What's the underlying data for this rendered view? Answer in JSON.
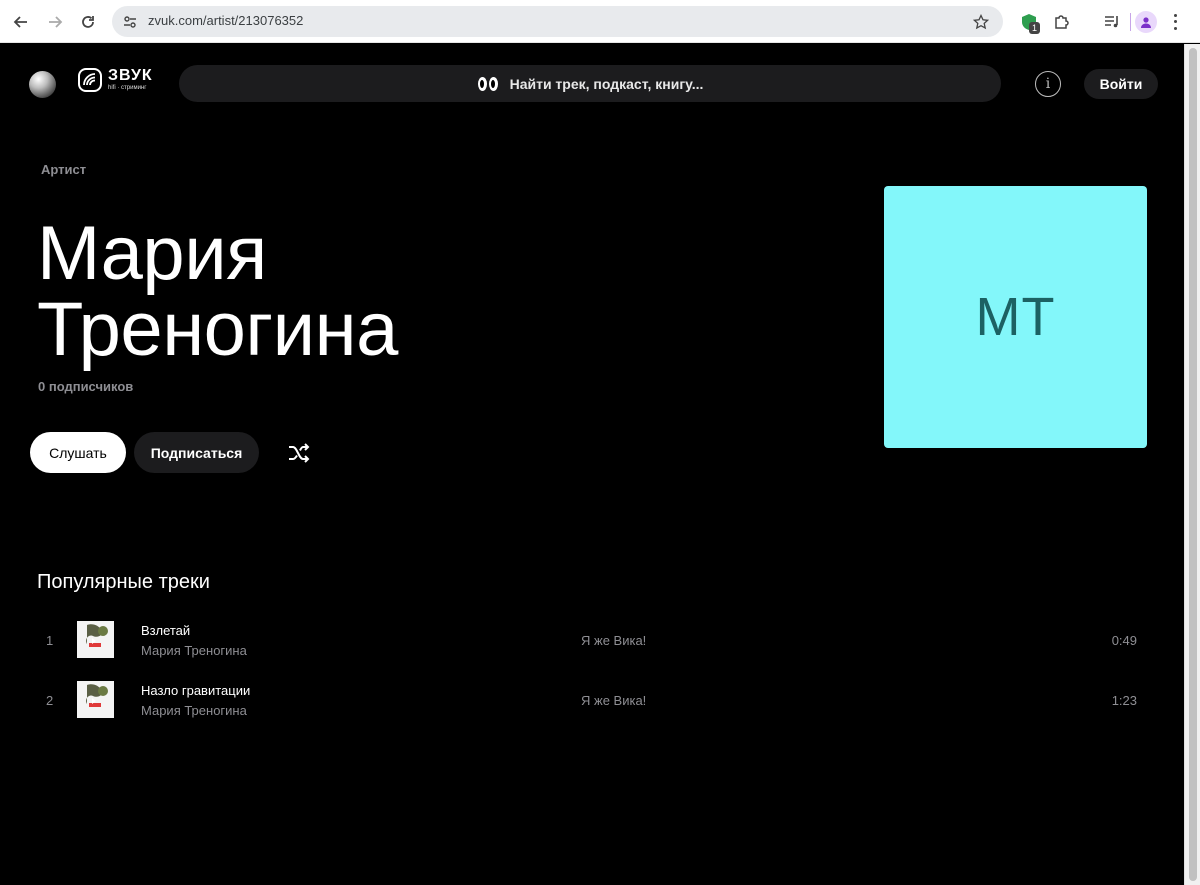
{
  "browser": {
    "url": "zvuk.com/artist/213076352",
    "extension_badge": "1"
  },
  "header": {
    "logo_name": "ЗВУК",
    "logo_sub": "hifi · стриминг",
    "search_placeholder": "Найти трек, подкаст, книгу...",
    "login_label": "Войти"
  },
  "artist": {
    "type_label": "Артист",
    "name_line1": "Мария",
    "name_line2": "Треногина",
    "subscribers": "0 подписчиков",
    "initials": "МТ",
    "cover_color": "#83f7fa",
    "listen_label": "Слушать",
    "subscribe_label": "Подписаться"
  },
  "popular": {
    "title": "Популярные треки",
    "tracks": [
      {
        "num": "1",
        "title": "Взлетай",
        "artist": "Мария Треногина",
        "album": "Я же Вика!",
        "duration": "0:49"
      },
      {
        "num": "2",
        "title": "Назло гравитации",
        "artist": "Мария Треногина",
        "album": "Я же Вика!",
        "duration": "1:23"
      }
    ]
  }
}
